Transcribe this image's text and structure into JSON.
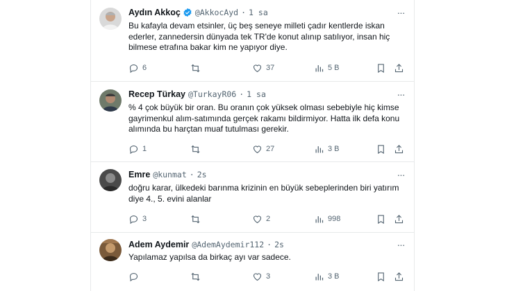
{
  "tweets": [
    {
      "name": "Aydın Akkoç",
      "verified": true,
      "handle": "@AkkocAyd",
      "dot": "·",
      "time": "1 sa",
      "text": "Bu kafayla devam etsinler, üç beş seneye milleti çadır kentlerde iskan\nederler, zannedersin dünyada tek TR'de konut alınıp satılıyor, insan hiç\nbilmese etrafına bakar kim ne yapıyor diye.",
      "replies": "6",
      "retweets": "",
      "likes": "37",
      "views": "5 B"
    },
    {
      "name": "Recep Türkay",
      "verified": false,
      "handle": "@TurkayR06",
      "dot": "·",
      "time": "1 sa",
      "text": "% 4 çok büyük bir oran. Bu oranın çok yüksek olması sebebiyle hiç kimse\ngayrimenkul alım-satımında gerçek rakamı bildirmiyor. Hatta ilk defa konu\nalımında bu harçtan muaf tutulması gerekir.",
      "replies": "1",
      "retweets": "",
      "likes": "27",
      "views": "3 B"
    },
    {
      "name": "Emre",
      "verified": false,
      "handle": "@kunmat",
      "dot": "·",
      "time": "2s",
      "text": "doğru karar, ülkedeki barınma krizinin en büyük sebeplerinden biri yatırım\ndiye 4., 5. evini alanlar",
      "replies": "3",
      "retweets": "",
      "likes": "2",
      "views": "998"
    },
    {
      "name": "Adem Aydemir",
      "verified": false,
      "handle": "@AdemAydemir112",
      "dot": "·",
      "time": "2s",
      "text": "Yapılamaz yapılsa da birkaç ayı var sadece.",
      "replies": "",
      "retweets": "",
      "likes": "3",
      "views": "3 B"
    }
  ],
  "colors": {
    "verified": "#1d9bf0",
    "secondary_text": "#536471",
    "divider": "#e7e9ea"
  },
  "icons": [
    "reply-icon",
    "retweet-icon",
    "like-icon",
    "views-icon",
    "bookmark-icon",
    "share-icon",
    "more-icon",
    "verified-icon"
  ]
}
